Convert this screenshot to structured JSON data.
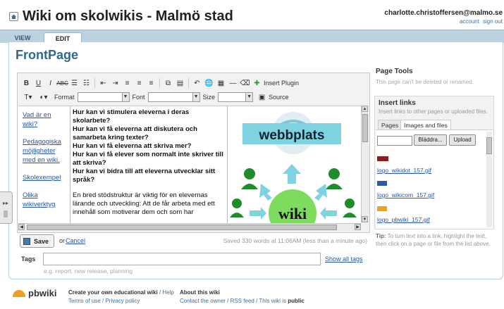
{
  "site": {
    "title": "Wiki om skolwikis - Malmö stad"
  },
  "user": {
    "email": "charlotte.christoffersen@malmo.se",
    "account": "account",
    "signout": "sign out"
  },
  "tabs": {
    "view": "VIEW",
    "edit": "EDIT"
  },
  "page": {
    "title": "FrontPage"
  },
  "toolbar": {
    "format_label": "Format",
    "font_label": "Font",
    "size_label": "Size",
    "insert_plugin": "Insert Plugin",
    "source": "Source"
  },
  "content": {
    "links": [
      "Vad är en wiki?",
      "Pedagogiska möjligheter med en wiki.",
      "Skolexempel",
      "Olika wikiverktyg"
    ],
    "questions": [
      "Hur kan vi stimulera eleverna i deras skolarbete?",
      "Hur kan vi få eleverna att diskutera och samarbeta kring texter?",
      "Hur kan vi få eleverna att skriva mer?",
      "Hur kan vi få elever som normalt inte skriver till att skriva?",
      "Hur kan vi bidra till att eleverna utvecklar sitt språk?"
    ],
    "paragraph": "En bred stödstruktur är viktig för en elevernas lärande och utveckling: Att de får arbeta med ett innehåll som motiverar dem och som har",
    "image_labels": {
      "top": "webbplats",
      "center": "wiki"
    }
  },
  "actions": {
    "save": "Save",
    "or": "or",
    "cancel": "Cancel",
    "saved_status": "Saved 330 words at 11:06AM (less than a minute ago)"
  },
  "tags": {
    "label": "Tags",
    "placeholder": "e.g. report, new release, planning",
    "show_all": "Show all tags"
  },
  "sidebar": {
    "page_tools_title": "Page Tools",
    "page_tools_note": "This page can't be deleted or renamed.",
    "insert_links_title": "Insert links",
    "insert_links_sub": "Insert links to other pages or uploaded files.",
    "tab_pages": "Pages",
    "tab_images": "Images and files",
    "browse": "Bläddra...",
    "upload": "Upload",
    "files": [
      "logo_wikidot_157.gif",
      "logo_wikicom_157.gif",
      "logo_pbwiki_157.gif"
    ],
    "tip_label": "Tip:",
    "tip_text": "To turn text into a link, highlight the text, then click on a page or file from the list above."
  },
  "footer": {
    "logo": "pbwiki",
    "col1_head": "Create your own educational wiki",
    "col1_help": "Help",
    "col1_line2": "Terms of use / Privacy policy",
    "col2_head": "About this wiki",
    "col2_line2": "Contact the owner / RSS feed / This wiki is",
    "col2_public": "public"
  }
}
